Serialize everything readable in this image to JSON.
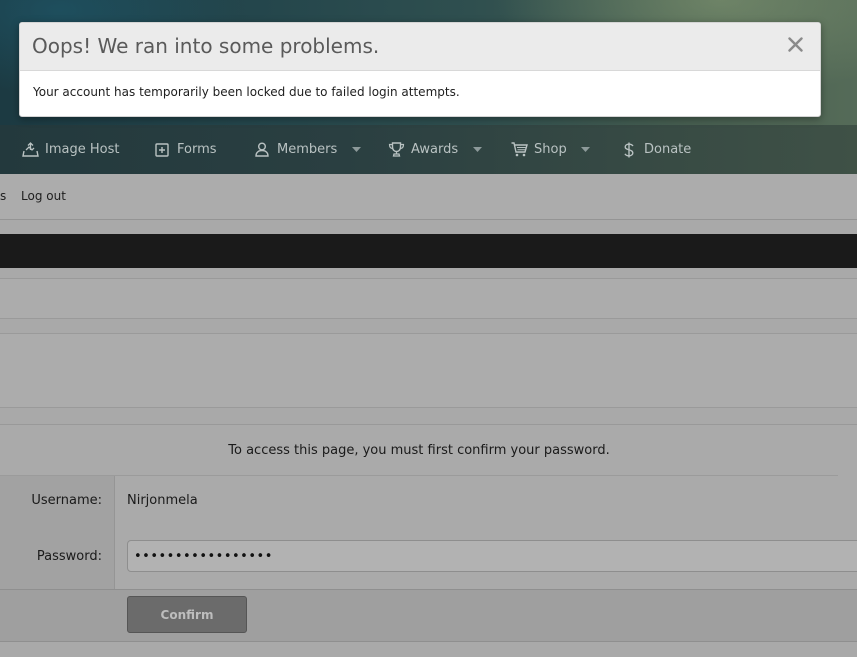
{
  "nav": {
    "items": [
      {
        "label": "Image Host",
        "icon": "image-upload-icon"
      },
      {
        "label": "Forms",
        "icon": "plus-square-icon"
      },
      {
        "label": "Members",
        "icon": "user-icon",
        "has_dropdown": true
      },
      {
        "label": "Awards",
        "icon": "trophy-icon",
        "has_dropdown": true
      },
      {
        "label": "Shop",
        "icon": "cart-icon",
        "has_dropdown": true
      },
      {
        "label": "Donate",
        "icon": "dollar-icon"
      }
    ]
  },
  "subnav": {
    "fragment": "s",
    "logout_label": "Log out"
  },
  "form": {
    "intro": "To access this page, you must first confirm your password.",
    "username_label": "Username:",
    "username_value": "Nirjonmela",
    "password_label": "Password:",
    "password_value": "•••••••••••••••••",
    "confirm_label": "Confirm"
  },
  "modal": {
    "title": "Oops! We ran into some problems.",
    "message": "Your account has temporarily been locked due to failed login attempts."
  },
  "colors": {
    "navbar": "#2a3f41",
    "nav_text": "#b9c2c2",
    "modal_header": "#ebebeb",
    "button": "#6b6b6b"
  }
}
